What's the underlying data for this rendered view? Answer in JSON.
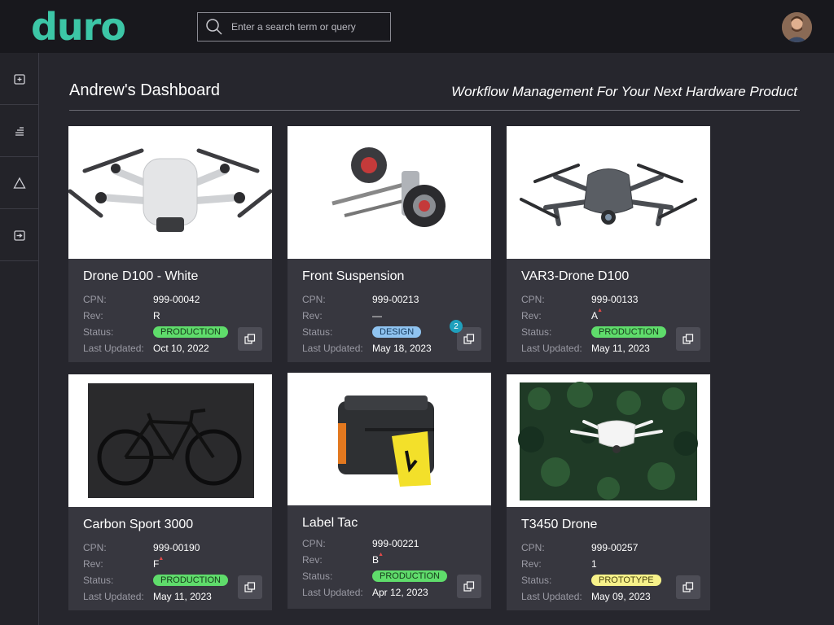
{
  "brand": {
    "logo_text": "duro",
    "accent": "#3cc6a6"
  },
  "search": {
    "placeholder": "Enter a search term or query"
  },
  "sidebar": {
    "items": [
      {
        "icon": "add-box-icon"
      },
      {
        "icon": "list-icon"
      },
      {
        "icon": "triangle-icon"
      },
      {
        "icon": "import-box-icon"
      }
    ]
  },
  "dashboard": {
    "title": "Andrew's Dashboard",
    "tagline": "Workflow Management For Your Next Hardware Product"
  },
  "labels": {
    "cpn": "CPN:",
    "rev": "Rev:",
    "status": "Status:",
    "updated": "Last Updated:"
  },
  "cards": [
    {
      "name": "Drone D100 - White",
      "cpn": "999-00042",
      "rev": "R",
      "rev_flag": "",
      "status": "PRODUCTION",
      "updated": "Oct 10, 2022",
      "notifications": ""
    },
    {
      "name": "Front Suspension",
      "cpn": "999-00213",
      "rev": "—",
      "rev_flag": "",
      "status": "DESIGN",
      "updated": "May 18, 2023",
      "notifications": "2"
    },
    {
      "name": "VAR3-Drone D100",
      "cpn": "999-00133",
      "rev": "A",
      "rev_flag": "▲",
      "status": "PRODUCTION",
      "updated": "May 11, 2023",
      "notifications": ""
    },
    {
      "name": "Carbon Sport 3000",
      "cpn": "999-00190",
      "rev": "F",
      "rev_flag": "▲",
      "status": "PRODUCTION",
      "updated": "May 11, 2023",
      "notifications": ""
    },
    {
      "name": "Label Tac",
      "cpn": "999-00221",
      "rev": "B",
      "rev_flag": "▲",
      "status": "PRODUCTION",
      "updated": "Apr 12, 2023",
      "notifications": ""
    },
    {
      "name": "T3450 Drone",
      "cpn": "999-00257",
      "rev": "1",
      "rev_flag": "",
      "status": "PROTOTYPE",
      "updated": "May 09, 2023",
      "notifications": ""
    }
  ]
}
